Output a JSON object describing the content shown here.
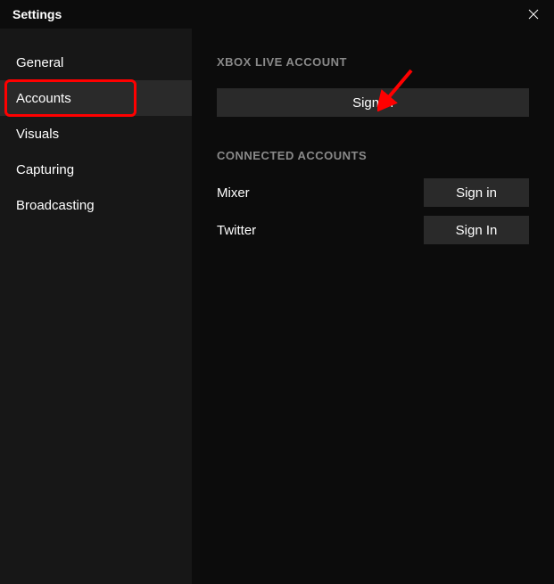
{
  "header": {
    "title": "Settings"
  },
  "sidebar": {
    "items": [
      {
        "label": "General"
      },
      {
        "label": "Accounts"
      },
      {
        "label": "Visuals"
      },
      {
        "label": "Capturing"
      },
      {
        "label": "Broadcasting"
      }
    ]
  },
  "main": {
    "xbox_section_header": "XBOX LIVE ACCOUNT",
    "xbox_signin_label": "Sign in",
    "connected_section_header": "CONNECTED ACCOUNTS",
    "accounts": [
      {
        "label": "Mixer",
        "button": "Sign in"
      },
      {
        "label": "Twitter",
        "button": "Sign In"
      }
    ]
  }
}
